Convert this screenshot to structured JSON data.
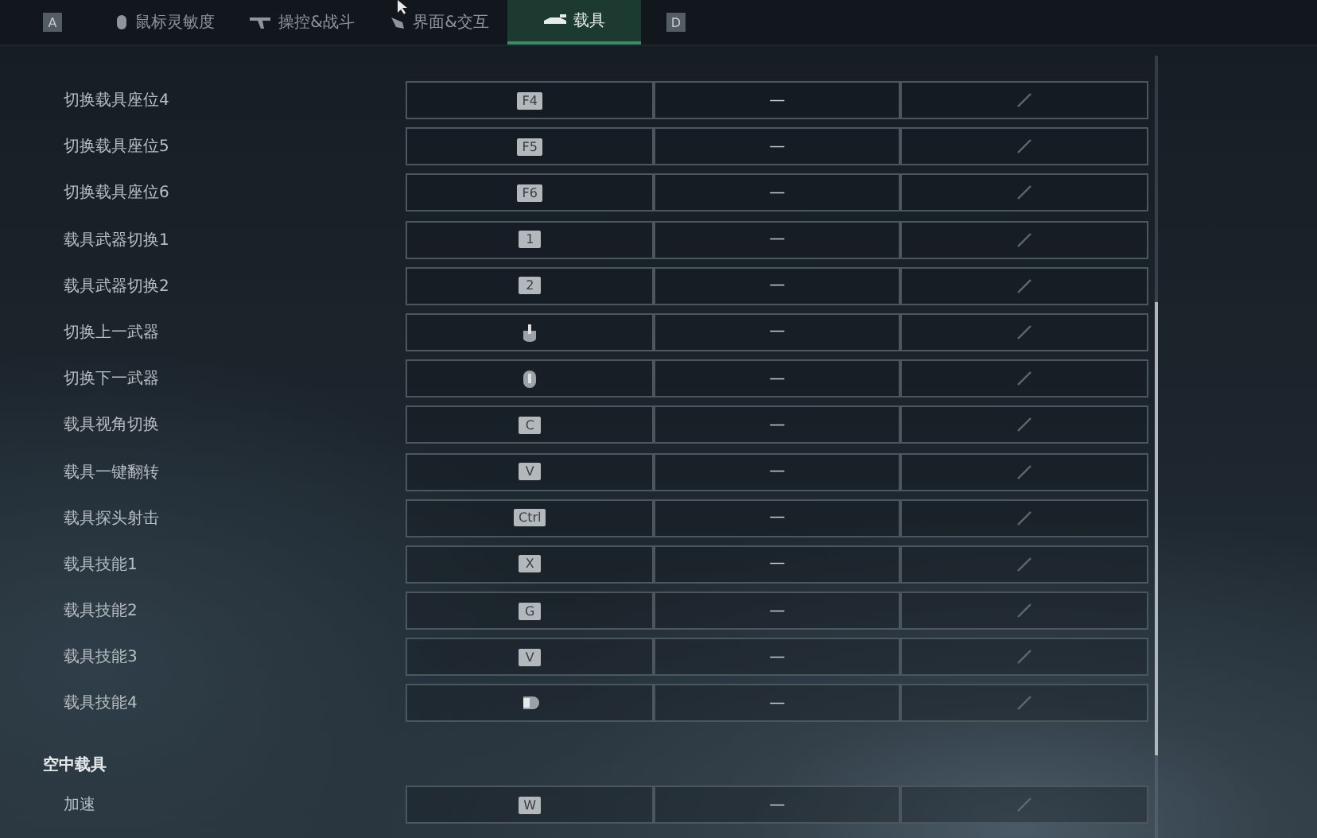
{
  "tabs": [
    {
      "kind": "hint",
      "label": "A",
      "selected": false
    },
    {
      "kind": "mouse",
      "label": "鼠标灵敏度",
      "selected": false
    },
    {
      "kind": "gun",
      "label": "操控&战斗",
      "selected": false
    },
    {
      "kind": "leaf",
      "label": "界面&交互",
      "selected": false
    },
    {
      "kind": "car",
      "label": "载具",
      "selected": true
    },
    {
      "kind": "hint",
      "label": "D",
      "selected": false
    }
  ],
  "rows": [
    {
      "kind": "binding",
      "label": "切换载具座位4",
      "primary": {
        "kind": "key",
        "label": "F4"
      },
      "secondary": "—"
    },
    {
      "kind": "binding",
      "label": "切换载具座位5",
      "primary": {
        "kind": "key",
        "label": "F5"
      },
      "secondary": "—"
    },
    {
      "kind": "binding",
      "label": "切换载具座位6",
      "primary": {
        "kind": "key",
        "label": "F6"
      },
      "secondary": "—"
    },
    {
      "kind": "binding",
      "label": "载具武器切换1",
      "primary": {
        "kind": "key",
        "label": "1"
      },
      "secondary": "—"
    },
    {
      "kind": "binding",
      "label": "载具武器切换2",
      "primary": {
        "kind": "key",
        "label": "2"
      },
      "secondary": "—"
    },
    {
      "kind": "binding",
      "label": "切换上一武器",
      "primary": {
        "kind": "wheel-up"
      },
      "secondary": "—"
    },
    {
      "kind": "binding",
      "label": "切换下一武器",
      "primary": {
        "kind": "wheel-down"
      },
      "secondary": "—"
    },
    {
      "kind": "binding",
      "label": "载具视角切换",
      "primary": {
        "kind": "key",
        "label": "C"
      },
      "secondary": "—"
    },
    {
      "kind": "binding",
      "label": "载具一键翻转",
      "primary": {
        "kind": "key",
        "label": "V"
      },
      "secondary": "—"
    },
    {
      "kind": "binding",
      "label": "载具探头射击",
      "primary": {
        "kind": "key",
        "label": "Ctrl"
      },
      "secondary": "—"
    },
    {
      "kind": "binding",
      "label": "载具技能1",
      "primary": {
        "kind": "key",
        "label": "X"
      },
      "secondary": "—"
    },
    {
      "kind": "binding",
      "label": "载具技能2",
      "primary": {
        "kind": "key",
        "label": "G"
      },
      "secondary": "—"
    },
    {
      "kind": "binding",
      "label": "载具技能3",
      "primary": {
        "kind": "key",
        "label": "V"
      },
      "secondary": "—"
    },
    {
      "kind": "binding",
      "label": "载具技能4",
      "primary": {
        "kind": "mouse-side"
      },
      "secondary": "—"
    },
    {
      "kind": "header",
      "label": "空中载具"
    },
    {
      "kind": "binding",
      "label": "加速",
      "primary": {
        "kind": "key",
        "label": "W"
      },
      "secondary": "—"
    }
  ]
}
